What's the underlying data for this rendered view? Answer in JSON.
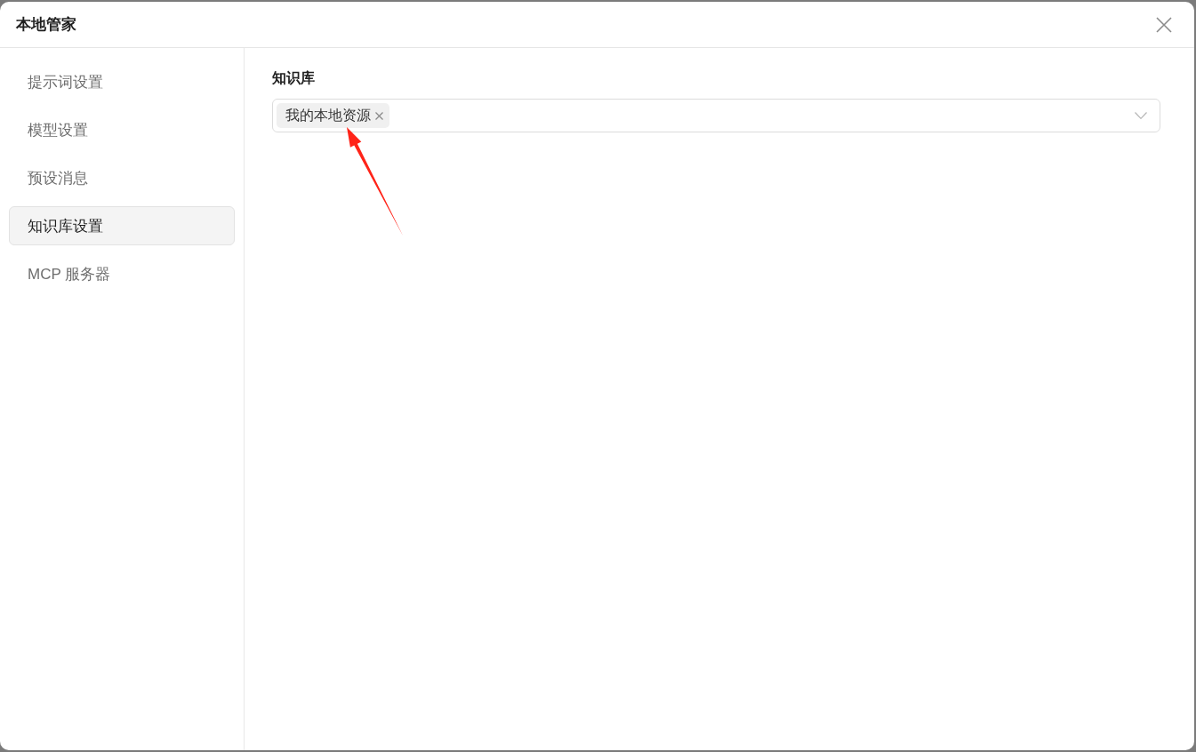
{
  "dialog": {
    "title": "本地管家"
  },
  "sidebar": {
    "items": [
      {
        "label": "提示词设置",
        "selected": false
      },
      {
        "label": "模型设置",
        "selected": false
      },
      {
        "label": "预设消息",
        "selected": false
      },
      {
        "label": "知识库设置",
        "selected": true
      },
      {
        "label": "MCP 服务器",
        "selected": false
      }
    ]
  },
  "knowledge_base": {
    "label": "知识库",
    "select": {
      "tags": [
        {
          "label": "我的本地资源"
        }
      ]
    }
  }
}
